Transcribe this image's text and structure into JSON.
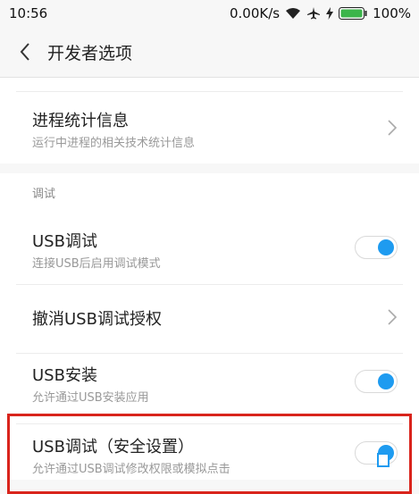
{
  "status": {
    "time": "10:56",
    "speed": "0.00K/s",
    "battery": "100%",
    "icons": [
      "wifi-icon",
      "airplane-icon",
      "charging-icon",
      "battery-icon"
    ],
    "battery_color": "#3bb54a"
  },
  "header": {
    "title": "开发者选项"
  },
  "items": {
    "process_stats": {
      "title": "进程统计信息",
      "subtitle": "运行中进程的相关技术统计信息"
    },
    "section_debug": "调试",
    "usb_debug": {
      "title": "USB调试",
      "subtitle": "连接USB后启用调试模式",
      "enabled": true
    },
    "revoke_usb": {
      "title": "撤消USB调试授权"
    },
    "usb_install": {
      "title": "USB安装",
      "subtitle": "允许通过USB安装应用",
      "enabled": true
    },
    "usb_debug_secure": {
      "title": "USB调试（安全设置）",
      "subtitle": "允许通过USB调试修改权限或模拟点击",
      "enabled": true
    }
  },
  "colors": {
    "accent": "#1e9bf0",
    "highlight": "#d9241c"
  }
}
